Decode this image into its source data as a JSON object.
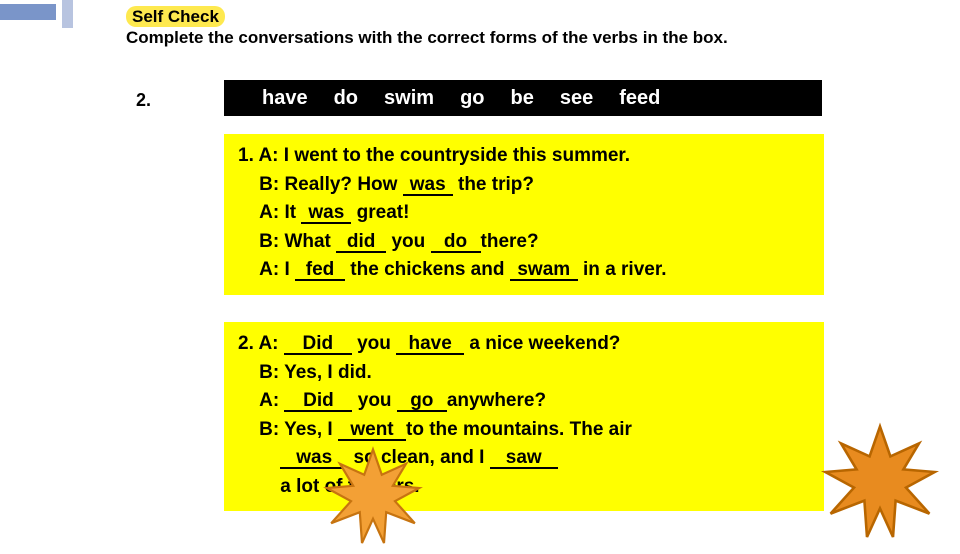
{
  "header": {
    "title": "Self Check",
    "instruction": "Complete the conversations with the correct forms of the verbs in the box."
  },
  "question_number": "2.",
  "verbs": [
    "have",
    "do",
    "swim",
    "go",
    "be",
    "see",
    "feed"
  ],
  "conv1": {
    "num": "1.",
    "l1_pre": "A: I went to the countryside this summer.",
    "l2_pre": "B: Really?  How",
    "l2_ans": "was",
    "l2_post": "the trip?",
    "l3_pre": "A: It",
    "l3_ans": "was",
    "l3_post": "great!",
    "l4_pre": "B: What",
    "l4_ans1": "did",
    "l4_mid": "you",
    "l4_ans2": "do",
    "l4_post": "there?",
    "l5_pre": "A: I",
    "l5_ans1": "fed",
    "l5_mid": "the chickens and",
    "l5_ans2": "swam",
    "l5_post": "in a river."
  },
  "conv2": {
    "num": "2.",
    "l1_pre": "A:",
    "l1_ans1": "Did",
    "l1_mid": "you",
    "l1_ans2": "have",
    "l1_post": "a nice weekend?",
    "l2": "B: Yes, I did.",
    "l3_pre": "A:",
    "l3_ans1": "Did",
    "l3_mid": "you",
    "l3_ans2": "go",
    "l3_post": "anywhere?",
    "l4_pre": "B:  Yes, I",
    "l4_ans": "went",
    "l4_post": "to the mountains. The air",
    "l5_ans1": "was",
    "l5_mid": "so clean, and I",
    "l5_ans2": "saw",
    "l6": "a lot of flowers."
  }
}
